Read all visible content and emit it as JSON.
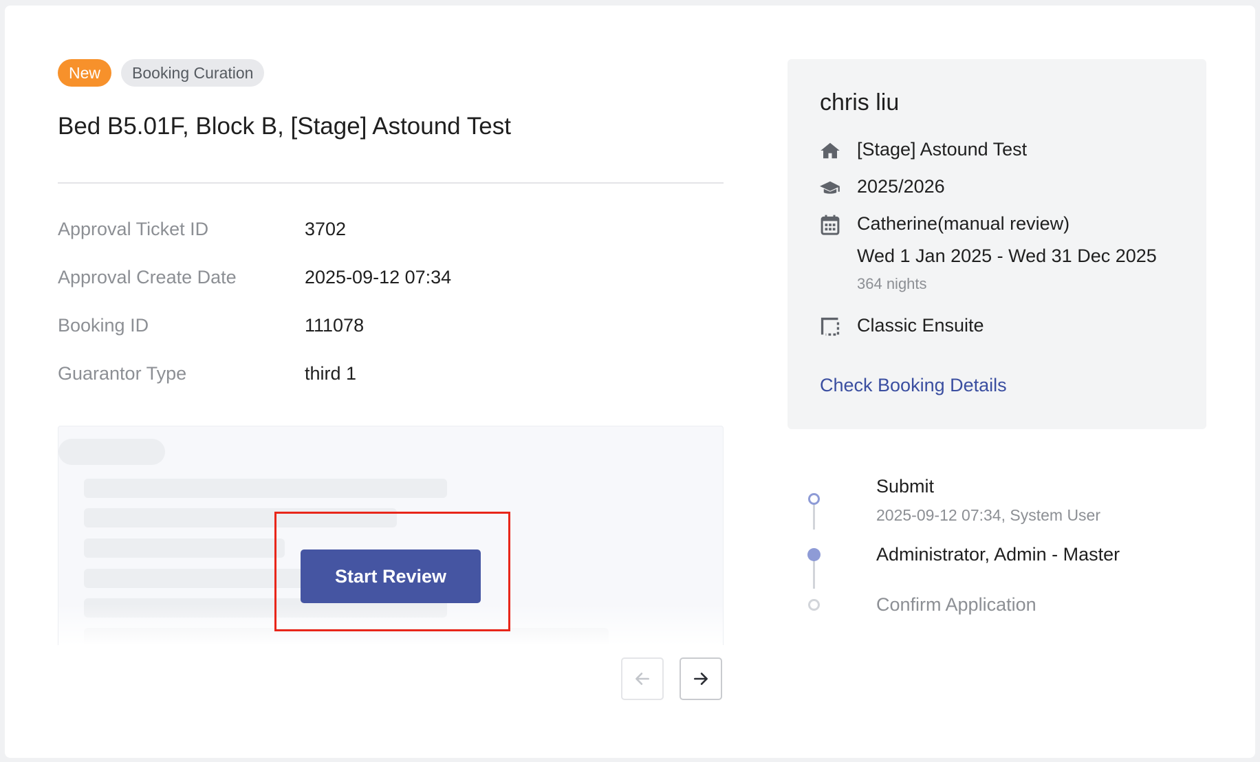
{
  "header": {
    "tag_new": "New",
    "tag_category": "Booking Curation",
    "title": "Bed B5.01F, Block B, [Stage] Astound Test"
  },
  "details": [
    {
      "label": "Approval Ticket ID",
      "value": "3702"
    },
    {
      "label": "Approval Create Date",
      "value": "2025-09-12 07:34"
    },
    {
      "label": "Booking ID",
      "value": "111078"
    },
    {
      "label": "Guarantor Type",
      "value": "third 1"
    }
  ],
  "preview": {
    "start_review_label": "Start Review"
  },
  "pager": {
    "prev_icon": "arrow-left-icon",
    "next_icon": "arrow-right-icon"
  },
  "sidebar": {
    "guest_name": "chris liu",
    "property": "[Stage] Astound Test",
    "academic_year": "2025/2026",
    "tenancy_name": "Catherine(manual review)",
    "date_range": "Wed 1 Jan 2025 - Wed 31 Dec 2025",
    "nights": "364 nights",
    "room_type": "Classic Ensuite",
    "check_link": "Check Booking Details",
    "icons": [
      "home-icon",
      "graduation-cap-icon",
      "calendar-icon",
      "room-icon"
    ]
  },
  "timeline": [
    {
      "title": "Submit",
      "meta": "2025-09-12 07:34, System User",
      "state": "done"
    },
    {
      "title": "Administrator, Admin - Master",
      "meta": "",
      "state": "current"
    },
    {
      "title": "Confirm Application",
      "meta": "",
      "state": "pending"
    }
  ],
  "colors": {
    "accent": "#4555a2",
    "tag_new": "#f7912b",
    "link": "#3a4ea0",
    "highlight_box": "#e8261a",
    "timeline_active": "#8e9bd6"
  }
}
